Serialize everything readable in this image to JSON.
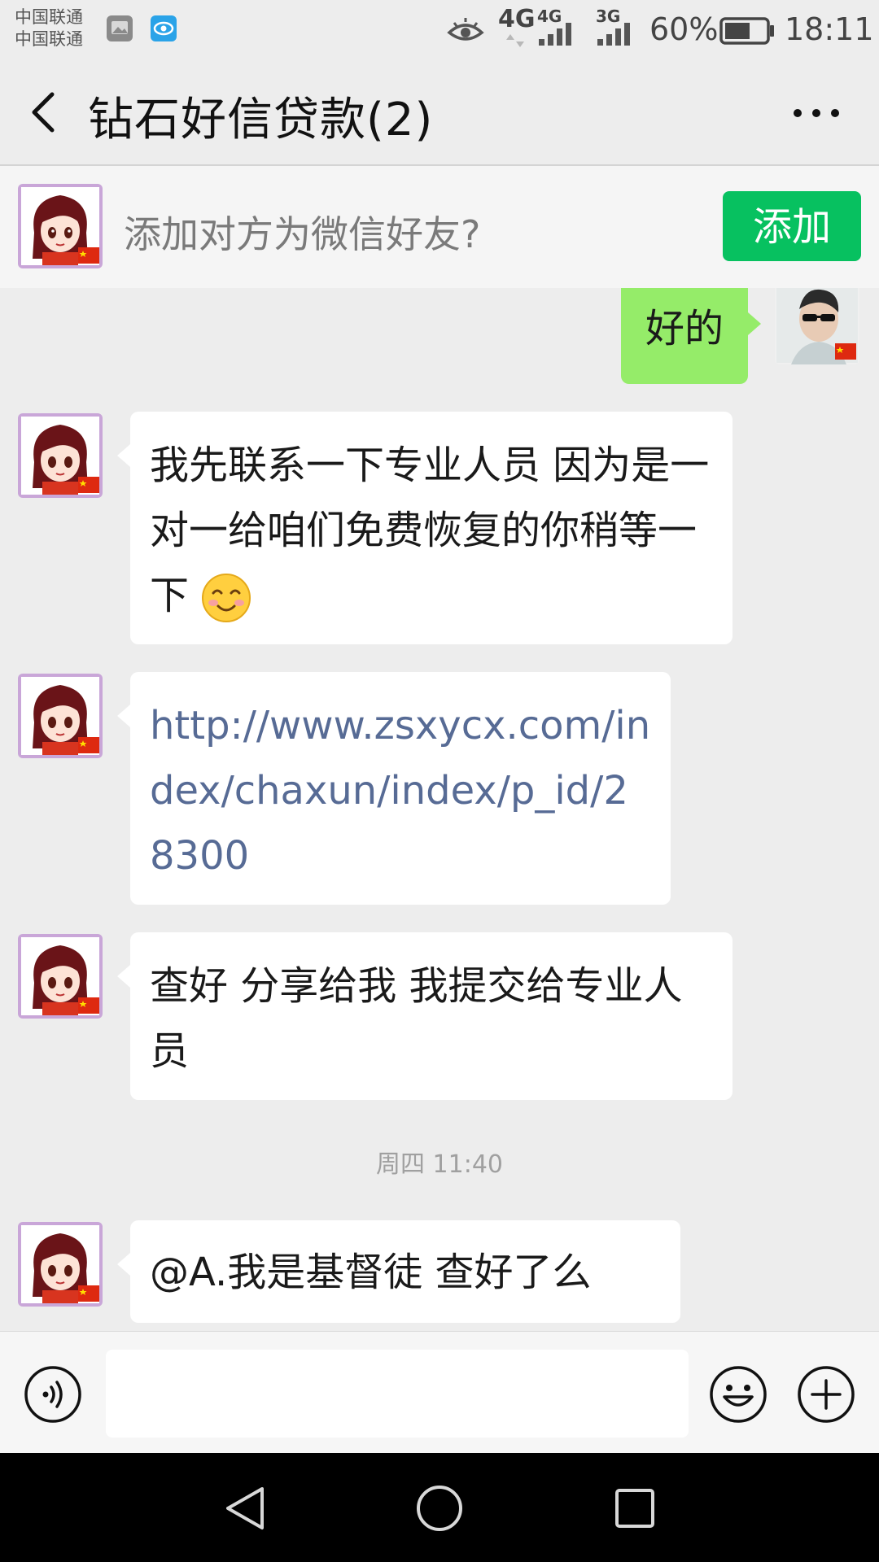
{
  "status_bar": {
    "carrier_1": "中国联通",
    "carrier_2": "中国联通",
    "network_1": "4G",
    "network_2": "4G",
    "network_3": "3G",
    "battery": "60%",
    "time": "18:11",
    "icons": [
      "gallery-notification-icon",
      "eye-notification-icon",
      "eye-comfort-icon",
      "signal-icon",
      "battery-icon"
    ]
  },
  "header": {
    "title": "钻石好信贷款(2)",
    "back_icon": "chevron-left-icon",
    "more_icon": "more-dots-icon"
  },
  "banner": {
    "prompt": "添加对方为微信好友?",
    "add_label": "添加"
  },
  "messages": [
    {
      "side": "right",
      "text": "好的"
    },
    {
      "side": "left",
      "text": "我先联系一下专业人员 因为是一对一给咱们免费恢复的你稍等一下",
      "emoji": "smiling-blush-emoji"
    },
    {
      "side": "left",
      "text": "http://www.zsxycx.com/index/chaxun/index/p_id/28300",
      "is_link": true
    },
    {
      "side": "left",
      "text": "查好 分享给我 我提交给专业人员"
    },
    {
      "side": "left",
      "text": "@A.我是基督徒 查好了么"
    }
  ],
  "timestamp": "周四 11:40",
  "input_bar": {
    "voice_icon": "voice-icon",
    "emoji_icon": "emoji-icon",
    "plus_icon": "plus-icon",
    "text_value": ""
  },
  "colors": {
    "accent": "#07C160",
    "sent_bubble": "#95EC69",
    "link": "#576B95",
    "background": "#EDEDED"
  }
}
